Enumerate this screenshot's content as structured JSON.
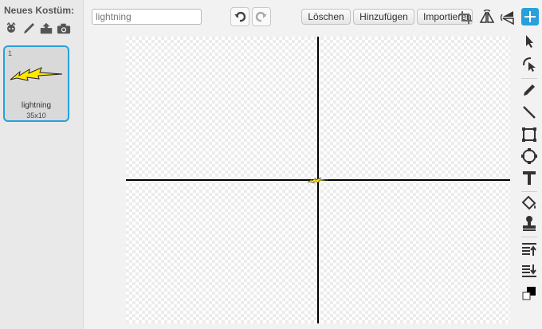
{
  "sidebar": {
    "new_costume_label": "Neues Kostüm:",
    "tools": [
      "paint-from-library-icon",
      "paint-new-icon",
      "upload-icon",
      "camera-icon"
    ],
    "costumes": [
      {
        "index": "1",
        "name": "lightning",
        "size": "35x10",
        "selected": true
      }
    ]
  },
  "toolbar": {
    "costume_name_value": "lightning",
    "undo_icon": "undo-icon",
    "redo_icon": "redo-icon",
    "clear_label": "Löschen",
    "add_label": "Hinzufügen",
    "import_label": "Importieren"
  },
  "colors": {
    "accent": "#29a0dc",
    "lightning_fill": "#ffe800",
    "axis": "#000000"
  }
}
